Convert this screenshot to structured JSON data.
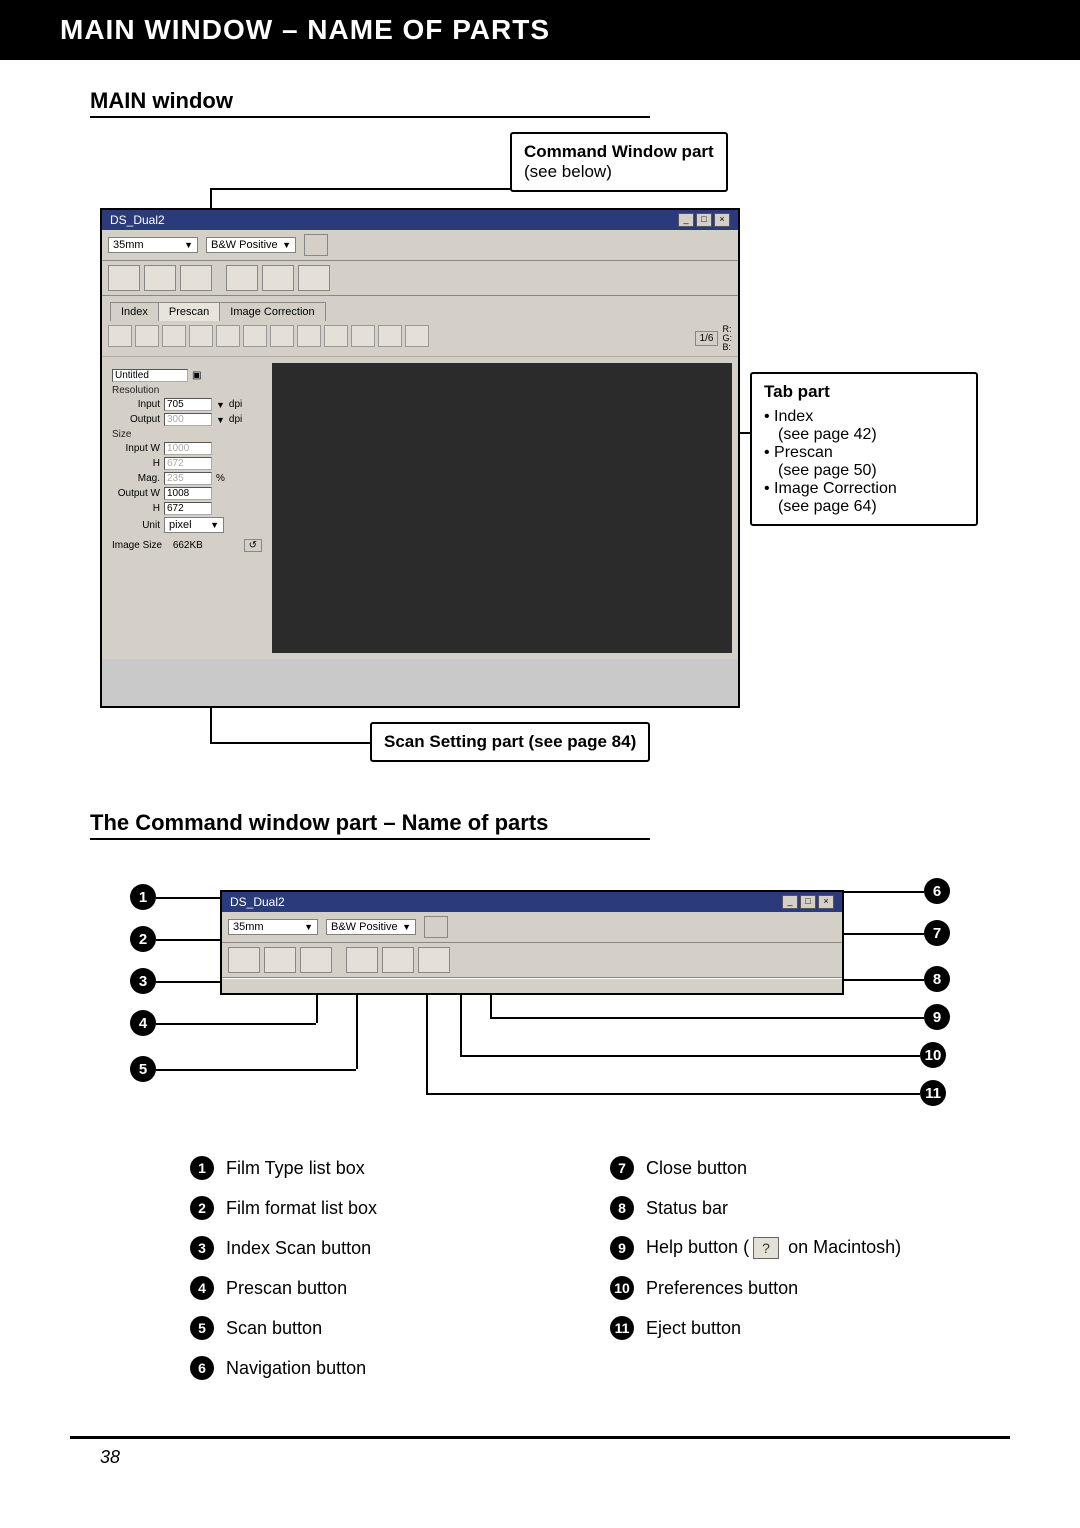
{
  "page_title": "MAIN WINDOW – NAME OF PARTS",
  "main_window_heading": "MAIN window",
  "callouts": {
    "command_window": {
      "title": "Command Window part",
      "sub": "(see below)"
    },
    "tab_part": {
      "title": "Tab part",
      "items": [
        {
          "bullet": "• Index",
          "ref": "(see page 42)"
        },
        {
          "bullet": "• Prescan",
          "ref": "(see page 50)"
        },
        {
          "bullet": "• Image Correction",
          "ref": "(see page 64)"
        }
      ]
    },
    "scan_setting": {
      "title": "Scan Setting part (see page 84)"
    }
  },
  "screenshot_main": {
    "window_title": "DS_Dual2",
    "film_format": "35mm",
    "film_type": "B&W Positive",
    "tabs": [
      "Index",
      "Prescan",
      "Image Correction"
    ],
    "rgb_label": "R:\nG:\nB:",
    "fraction": "1/6",
    "side_panel": {
      "title_field": "Untitled",
      "resolution_label": "Resolution",
      "input_label": "Input",
      "input_value": "705",
      "input_unit": "dpi",
      "output_label": "Output",
      "output_value": "300",
      "output_unit": "dpi",
      "size_label": "Size",
      "inputw_label": "Input W",
      "inputw_value": "1000",
      "h_label": "H",
      "h_value": "672",
      "mag_label": "Mag.",
      "mag_value": "235",
      "mag_unit": "%",
      "outputw_label": "Output W",
      "outputw_value": "1008",
      "h2_label": "H",
      "h2_value": "672",
      "unit_label": "Unit",
      "unit_value": "pixel",
      "image_size_label": "Image Size",
      "image_size_value": "662KB"
    }
  },
  "command_heading": "The Command window part – Name of parts",
  "cmd_window_title": "DS_Dual2",
  "cmd_film_format": "35mm",
  "cmd_film_type": "B&W Positive",
  "legend_left": [
    {
      "n": "1",
      "text": "Film Type list box"
    },
    {
      "n": "2",
      "text": "Film format list box"
    },
    {
      "n": "3",
      "text": "Index Scan button"
    },
    {
      "n": "4",
      "text": "Prescan button"
    },
    {
      "n": "5",
      "text": "Scan button"
    },
    {
      "n": "6",
      "text": "Navigation button"
    }
  ],
  "legend_right": [
    {
      "n": "7",
      "text": "Close button"
    },
    {
      "n": "8",
      "text": "Status bar"
    },
    {
      "n": "9",
      "text_pre": "Help button (",
      "text_post": " on Macintosh)"
    },
    {
      "n": "10",
      "text": "Preferences button"
    },
    {
      "n": "11",
      "text": "Eject button"
    }
  ],
  "page_number": "38"
}
